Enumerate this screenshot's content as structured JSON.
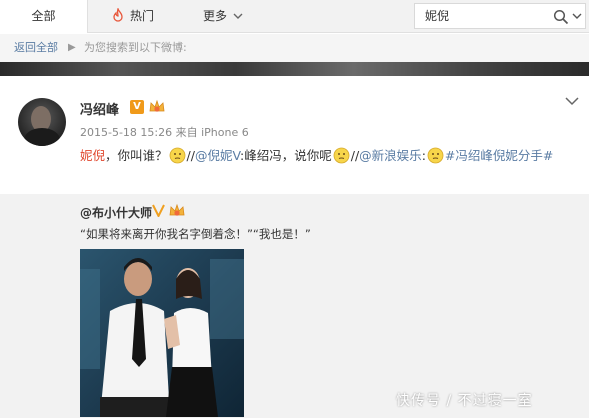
{
  "nav": {
    "tabs": [
      {
        "label": "全部",
        "active": true
      },
      {
        "label": "热门",
        "icon": "fire-icon"
      },
      {
        "label": "更多",
        "icon": "chevron-down-icon"
      }
    ],
    "search": {
      "value": "妮倪"
    }
  },
  "breadcrumb": {
    "back": "返回全部",
    "arrow": "▶",
    "hint": "为您搜索到以下微博:"
  },
  "post": {
    "username": "冯绍峰",
    "verified_badge": "V",
    "meta": "2015-5-18 15:26 来自 iPhone 6",
    "content": {
      "highlight": "妮倪",
      "part1": "，你叫谁？",
      "part2": "//",
      "mention1": "@倪妮V",
      "part3": ":峰绍冯，说你呢",
      "part4": "//",
      "mention2": "@新浪娱乐",
      "part5": ":",
      "hashtag": "#冯绍峰倪妮分手#"
    }
  },
  "repost": {
    "username": "@布小什大师",
    "text": "“如果将来离开你我名字倒着念！”“我也是！”"
  },
  "watermark": "快传号 / 不过寝一室",
  "colors": {
    "link": "#5a7ca3",
    "highlight": "#e0472e",
    "verified": "#f09a1a"
  }
}
